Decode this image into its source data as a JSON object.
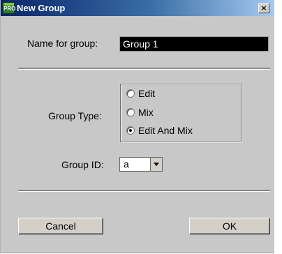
{
  "window": {
    "title": "New Group",
    "app_icon_text": "PRO",
    "close_glyph": "×"
  },
  "form": {
    "name_label": "Name for group:",
    "name_value": "Group 1",
    "group_type_label": "Group Type:",
    "group_type_options": [
      {
        "label": "Edit",
        "selected": false
      },
      {
        "label": "Mix",
        "selected": false
      },
      {
        "label": "Edit And Mix",
        "selected": true
      }
    ],
    "group_id_label": "Group ID:",
    "group_id_value": "a"
  },
  "buttons": {
    "cancel": "Cancel",
    "ok": "OK"
  },
  "icons": {
    "app": "pro-tools-icon",
    "close": "close-icon",
    "dropdown": "chevron-down-icon"
  }
}
